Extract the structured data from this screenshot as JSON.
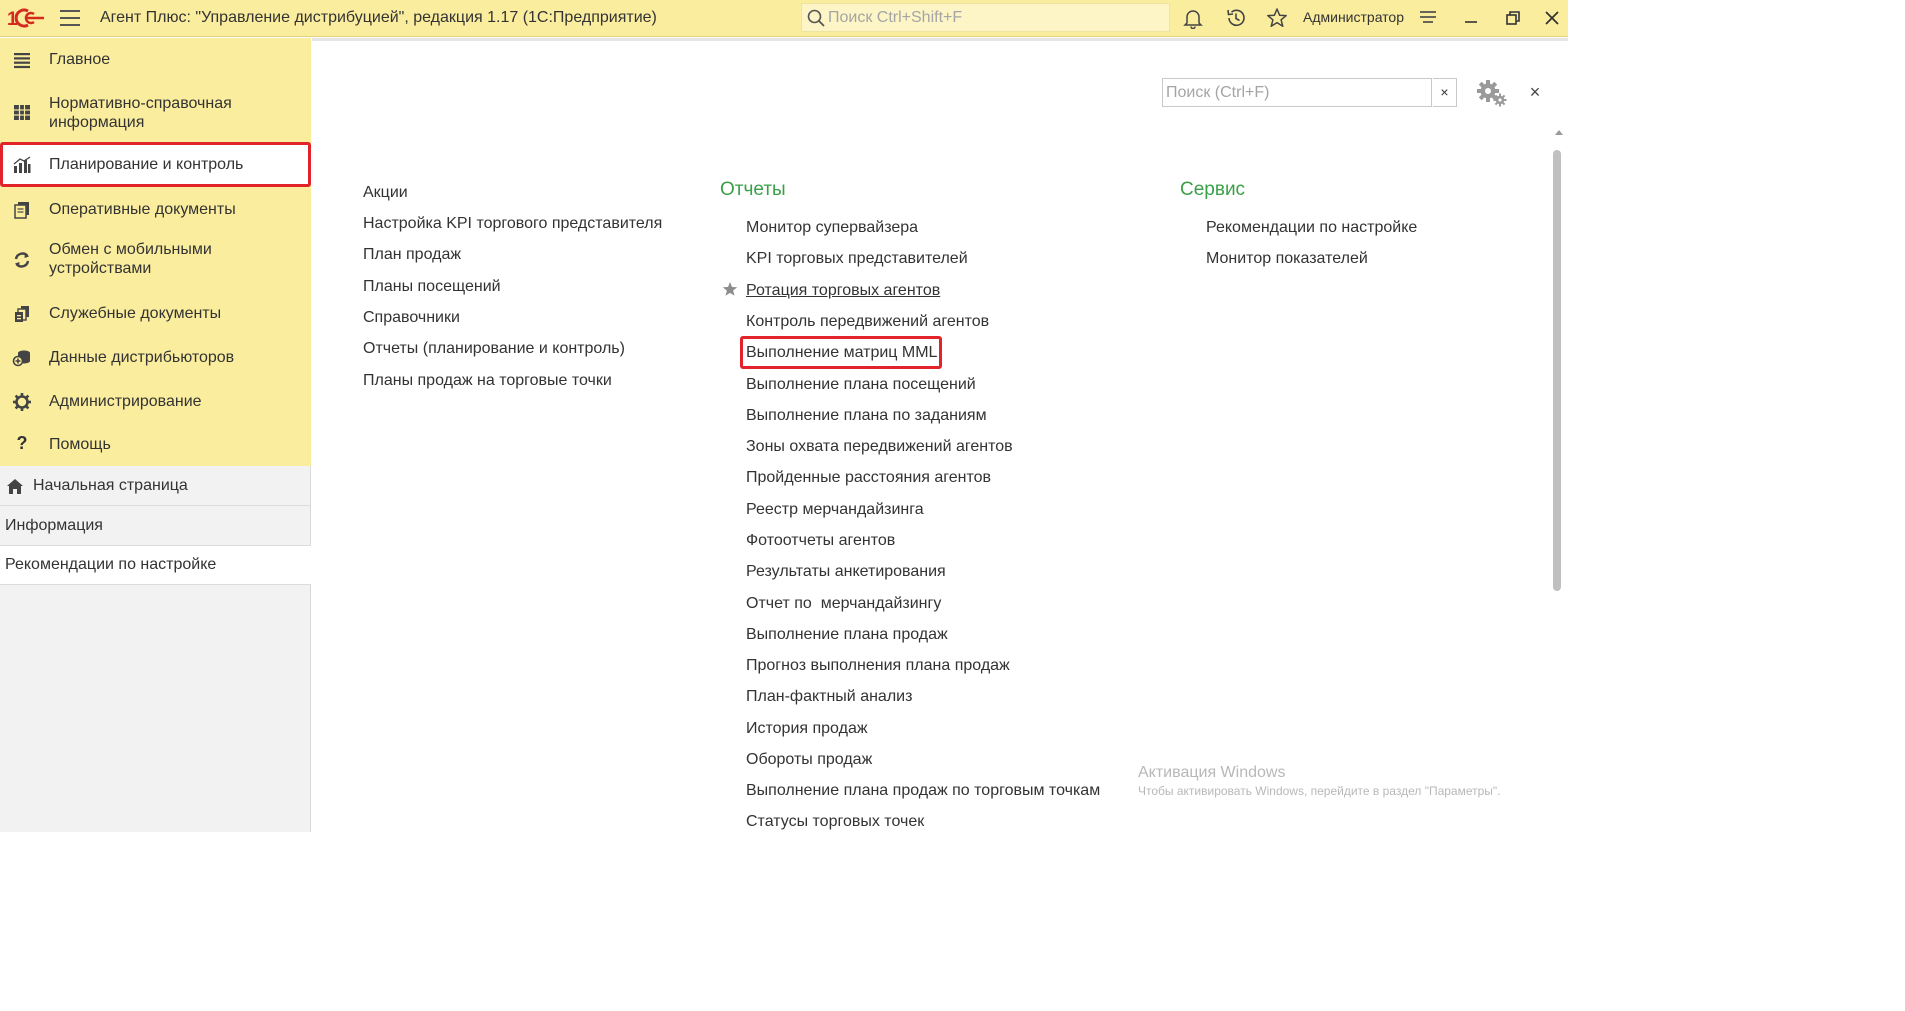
{
  "titlebar": {
    "app_title": "Агент Плюс: \"Управление дистрибуцией\", редакция 1.17  (1С:Предприятие)",
    "search_placeholder": "Поиск Ctrl+Shift+F",
    "user_name": "Администратор",
    "icons": [
      "1c-logo-icon",
      "menu-icon",
      "search-icon",
      "bell-icon",
      "history-icon",
      "star-icon",
      "settings-lines-icon",
      "minimize-icon",
      "restore-icon",
      "close-icon"
    ]
  },
  "sidebar": {
    "sections": [
      {
        "label": "Главное",
        "icon": "list-icon"
      },
      {
        "label": "Нормативно-справочная\nинформация",
        "icon": "table-icon"
      },
      {
        "label": "Планирование и контроль",
        "icon": "bar-chart-icon"
      },
      {
        "label": "Оперативные документы",
        "icon": "documents-icon"
      },
      {
        "label": "Обмен с мобильными\nустройствами",
        "icon": "sync-icon"
      },
      {
        "label": "Служебные документы",
        "icon": "service-docs-icon"
      },
      {
        "label": "Данные дистрибьюторов",
        "icon": "distributor-icon"
      },
      {
        "label": "Администрирование",
        "icon": "gear-icon"
      },
      {
        "label": "Помощь",
        "icon": "question-icon"
      }
    ],
    "favorites": [
      {
        "label": "Начальная страница",
        "icon": "home-icon"
      },
      {
        "label": "Информация"
      },
      {
        "label": "Рекомендации по настройке"
      }
    ]
  },
  "main": {
    "search_placeholder": "Поиск (Ctrl+F)",
    "clear_label": "×",
    "close_label": "×",
    "col1": {
      "items": [
        "Акции",
        "Настройка KPI торгового представителя",
        "План продаж",
        "Планы посещений",
        "Справочники",
        "Отчеты (планирование и контроль)",
        "Планы продаж на торговые точки"
      ]
    },
    "col2": {
      "header": "Отчеты",
      "items": [
        "Монитор супервайзера",
        "KPI торговых представителей",
        "Ротация торговых агентов",
        "Контроль передвижений агентов",
        "Выполнение матриц MML",
        "Выполнение плана посещений",
        "Выполнение плана по заданиям",
        "Зоны охвата передвижений агентов",
        "Пройденные расстояния агентов",
        "Реестр мерчандайзинга",
        "Фотоотчеты агентов",
        "Результаты анкетирования",
        "Отчет по  мерчандайзингу",
        "Выполнение плана продаж",
        "Прогноз выполнения плана продаж",
        "План-фактный анализ",
        "История продаж",
        "Обороты продаж",
        "Выполнение плана продаж по торговым точкам",
        "Статусы торговых точек"
      ]
    },
    "col3": {
      "header": "Сервис",
      "items": [
        "Рекомендации по настройке",
        "Монитор показателей"
      ]
    }
  },
  "watermark": {
    "title": "Активация Windows",
    "subtitle": "Чтобы активировать Windows, перейдите в раздел \"Параметры\"."
  },
  "colors": {
    "panel_yellow": "#fbed9e",
    "header_green": "#3aa047",
    "highlight_red": "#e2232a"
  }
}
